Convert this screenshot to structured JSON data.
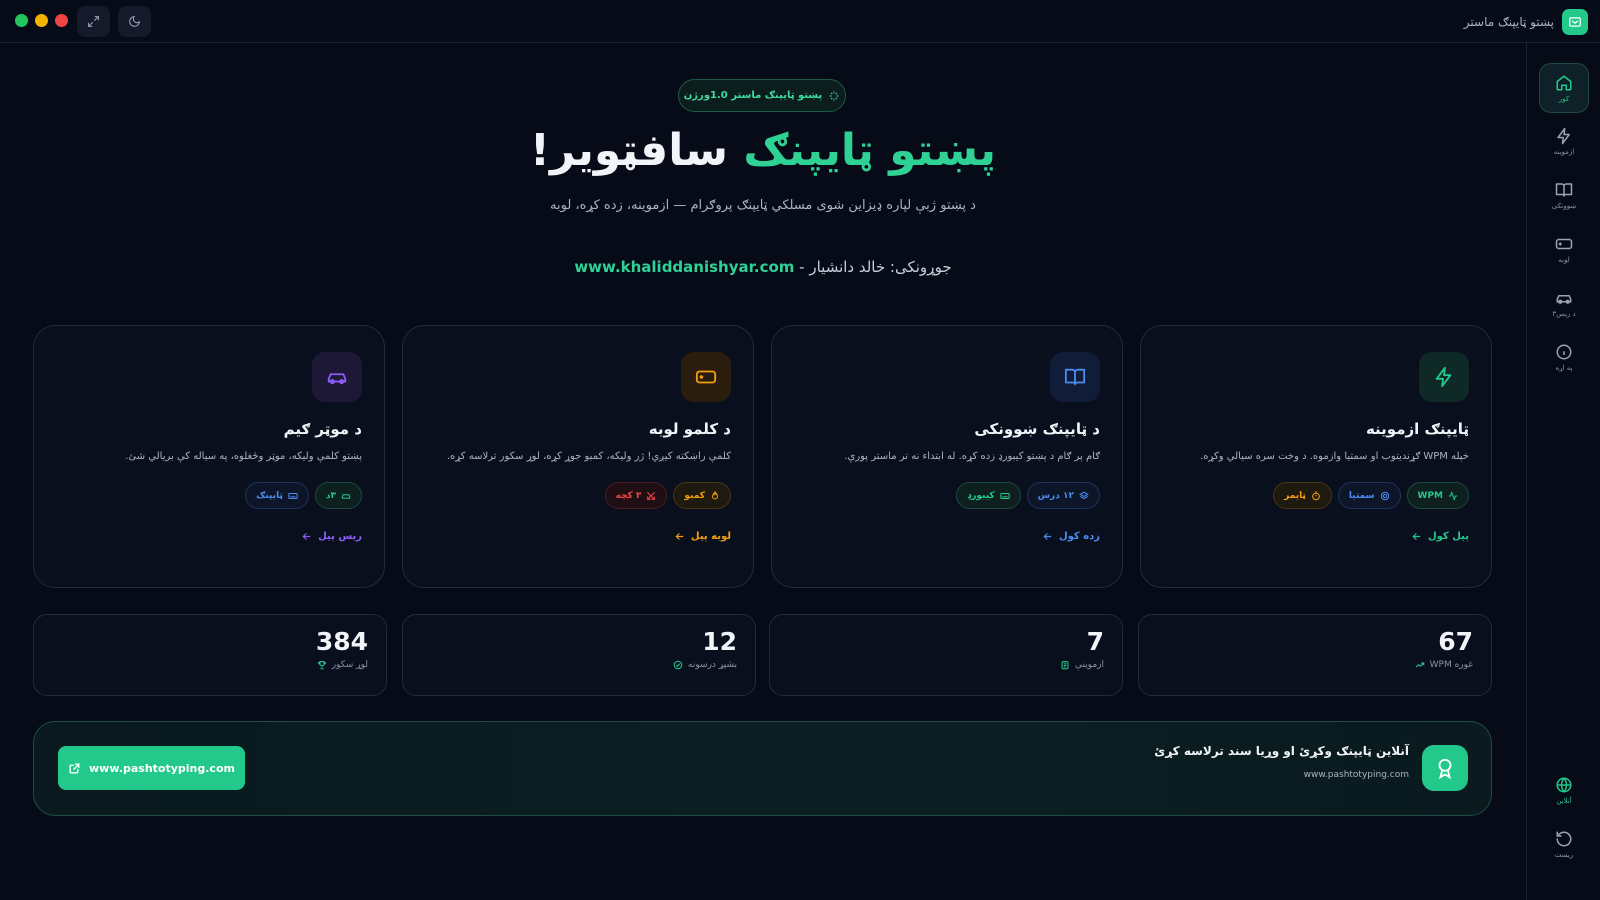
{
  "window": {
    "app_title": "پښتو ټايپنګ ماستر",
    "traffic_colors": [
      "#22c55e",
      "#f5b301",
      "#ef4444"
    ]
  },
  "rail": {
    "items": [
      {
        "label": "کور",
        "icon": "home-icon",
        "active": true
      },
      {
        "label": "ازموينه",
        "icon": "bolt-icon"
      },
      {
        "label": "ښوونکی",
        "icon": "book-icon"
      },
      {
        "label": "لوبه",
        "icon": "gamepad-icon"
      },
      {
        "label": "۳د ریس",
        "icon": "car-icon"
      },
      {
        "label": "په اړه",
        "icon": "info-icon"
      }
    ],
    "bottom": [
      {
        "label": "آنلاين",
        "icon": "globe-icon"
      },
      {
        "label": "ریست",
        "icon": "reset-icon"
      }
    ]
  },
  "hero": {
    "badge": "پښتو ټایپنګ ماستر 1.0ورژن",
    "title_highlight": "پښتو ټایپنګ",
    "title_rest": " سافټویر!",
    "subtitle": "د پښتو ژبې لپاره ډیزاین شوی مسلکي ټایپنګ پروګرام — ازموینه، زده کړه، لوبه",
    "author_label": "جوړونکی: خالد دانشیار - ",
    "author_link": "www.khaliddanishyar.com"
  },
  "cards": [
    {
      "title": "ټایپنګ ازموینه",
      "desc": "خپله WPM ګړندیتوب او سمتیا وازموه. د وخت سره سیالي وکړه.",
      "tags": [
        {
          "label": "WPM",
          "icon": "activity-icon"
        },
        {
          "label": "سمتیا",
          "icon": "target-icon"
        },
        {
          "label": "ټایمر",
          "icon": "timer-icon"
        }
      ],
      "link": "پیل کول",
      "accent": "#22c98a"
    },
    {
      "title": "د ټایپنګ ښوونکی",
      "desc": "ګام پر ګام د پښتو کیبورډ زده کړه. له ابتداء نه تر ماستر پورې.",
      "tags": [
        {
          "label": "۱۲ درس",
          "icon": "layers-icon"
        },
        {
          "label": "کیبورډ",
          "icon": "keyboard-icon"
        }
      ],
      "link": "زده کول",
      "accent": "#4a8cf0"
    },
    {
      "title": "د کلمو لوبه",
      "desc": "کلمې راښکته کیږي! ژر ولیکه، کمبو جوړ کړه، لوړ سکور ترلاسه کړه.",
      "tags": [
        {
          "label": "کمبو",
          "icon": "flame-icon"
        },
        {
          "label": "۳ کچه",
          "icon": "swords-icon"
        }
      ],
      "link": "لوبه پیل",
      "accent": "#f59e0b"
    },
    {
      "title": "د موټر ګیم",
      "desc": "پښتو کلمې ولیکه، موټر وځغلوه، په سیاله کې بریالي شئ.",
      "tags": [
        {
          "label": "۳د",
          "icon": "car-icon"
        },
        {
          "label": "ټایپنګ",
          "icon": "keyboard-icon"
        }
      ],
      "link": "ریس پیل",
      "accent": "#8b5cf6"
    }
  ],
  "stats": [
    {
      "value": "67",
      "label": "غوره WPM",
      "icon": "trend-icon"
    },
    {
      "value": "7",
      "label": "ازموینې",
      "icon": "clipboard-icon"
    },
    {
      "value": "12",
      "label": "بشپړ درسونه",
      "icon": "check-icon"
    },
    {
      "value": "384",
      "label": "لوړ سکور",
      "icon": "trophy-icon"
    }
  ],
  "banner": {
    "title": "آنلاین ټایپنګ وکړئ او وړیا سند ترلاسه کړئ",
    "url": "www.pashtotyping.com",
    "button": "www.pashtotyping.com"
  }
}
